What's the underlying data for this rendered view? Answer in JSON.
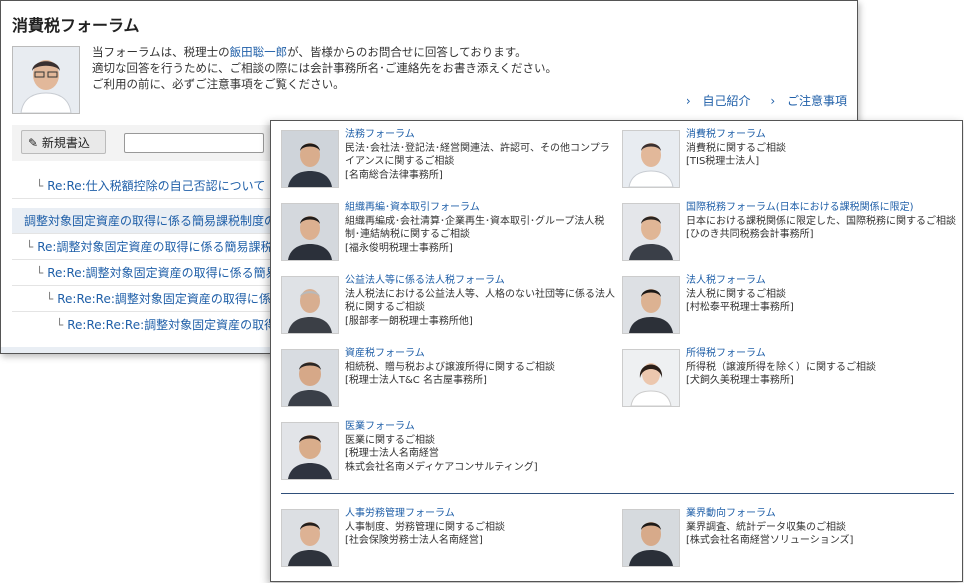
{
  "back_window": {
    "title": "消費税フォーラム",
    "intro_before": "当フォーラムは、税理士の",
    "intro_name": "飯田聡一郎",
    "intro_after": "が、皆様からのお問合せに回答しております。",
    "intro_line2": "適切な回答を行うために、ご相談の際には会計事務所名･ご連絡先をお書き添えください。",
    "intro_line3": "ご利用の前に、必ずご注意事項をご覧ください。",
    "link_profile": "自己紹介",
    "link_notice": "ご注意事項",
    "new_post_label": "新規書込",
    "threads": [
      {
        "text": "Re:Re:仕入税額控除の自己否認について",
        "level": 1
      },
      {
        "text": "調整対象固定資産の取得に係る簡易課税制度の適用",
        "level": 0
      },
      {
        "text": "Re:調整対象固定資産の取得に係る簡易課税制度",
        "level": 1
      },
      {
        "text": "Re:Re:調整対象固定資産の取得に係る簡易課税",
        "level": 2
      },
      {
        "text": "Re:Re:Re:調整対象固定資産の取得に係る簡易",
        "level": 3
      },
      {
        "text": "Re:Re:Re:Re:調整対象固定資産の取得に係る簡易",
        "level": 4
      }
    ]
  },
  "forums": [
    {
      "name": "法務フォーラム",
      "desc": "民法･会社法･登記法･経営関連法、許認可、その他コンプライアンスに関するご相談",
      "firm": "[名南総合法律事務所]"
    },
    {
      "name": "消費税フォーラム",
      "desc": "消費税に関するご相談",
      "firm": "[TIS税理士法人]"
    },
    {
      "name": "組織再編･資本取引フォーラム",
      "desc": "組織再編成･会社清算･企業再生･資本取引･グループ法人税制･連結納税に関するご相談",
      "firm": "[福永俊明税理士事務所]"
    },
    {
      "name": "国際税務フォーラム(日本における課税関係に限定)",
      "desc": "日本における課税関係に限定した、国際税務に関するご相談",
      "firm": "[ひのき共同税務会計事務所]"
    },
    {
      "name": "公益法人等に係る法人税フォーラム",
      "desc": "法人税法における公益法人等、人格のない社団等に係る法人税に関するご相談",
      "firm": "[服部孝一朗税理士事務所他]"
    },
    {
      "name": "法人税フォーラム",
      "desc": "法人税に関するご相談",
      "firm": "[村松泰平税理士事務所]"
    },
    {
      "name": "資産税フォーラム",
      "desc": "相続税、贈与税および譲渡所得に関するご相談",
      "firm": "[税理士法人T&C 名古屋事務所]"
    },
    {
      "name": "所得税フォーラム",
      "desc": "所得税（譲渡所得を除く）に関するご相談",
      "firm": "[犬飼久美税理士事務所]"
    },
    {
      "name": "医業フォーラム",
      "desc": "医業に関するご相談",
      "firm": "[税理士法人名南経営",
      "firm2": "株式会社名南メディケアコンサルティング]"
    },
    {
      "name": "人事労務管理フォーラム",
      "desc": "人事制度、労務管理に関するご相談",
      "firm": "[社会保険労務士法人名南経営]"
    },
    {
      "name": "業界動向フォーラム",
      "desc": "業界調査、統計データ収集のご相談",
      "firm": "[株式会社名南経営ソリューションズ]"
    }
  ],
  "colors": {
    "link": "#1f5fa8",
    "divider": "#2f4f7a",
    "highlight_row": "#e9eef4"
  }
}
